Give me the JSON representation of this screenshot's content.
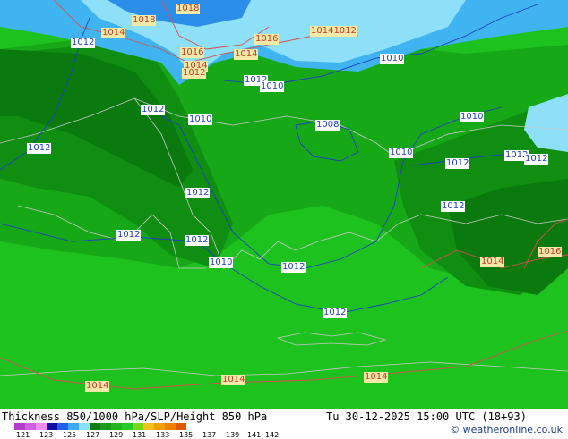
{
  "map": {
    "labels": [
      {
        "text": "1018",
        "color": "red"
      },
      {
        "text": "1018",
        "color": "red"
      },
      {
        "text": "1014",
        "color": "red"
      },
      {
        "text": "1012",
        "color": "blue"
      },
      {
        "text": "1016",
        "color": "red"
      },
      {
        "text": "10141012",
        "color": "red"
      },
      {
        "text": "1016",
        "color": "red"
      },
      {
        "text": "1014",
        "color": "red"
      },
      {
        "text": "1014",
        "color": "red"
      },
      {
        "text": "1012",
        "color": "red"
      },
      {
        "text": "1010",
        "color": "blue"
      },
      {
        "text": "1012",
        "color": "blue"
      },
      {
        "text": "1010",
        "color": "blue"
      },
      {
        "text": "1012",
        "color": "blue"
      },
      {
        "text": "1010",
        "color": "blue"
      },
      {
        "text": "1008",
        "color": "blue"
      },
      {
        "text": "1010",
        "color": "blue"
      },
      {
        "text": "1012",
        "color": "blue"
      },
      {
        "text": "1010",
        "color": "blue"
      },
      {
        "text": "1012",
        "color": "blue"
      },
      {
        "text": "1012",
        "color": "blue"
      },
      {
        "text": "1012",
        "color": "blue"
      },
      {
        "text": "1012",
        "color": "blue"
      },
      {
        "text": "1012",
        "color": "blue"
      },
      {
        "text": "1012",
        "color": "blue"
      },
      {
        "text": "1012",
        "color": "blue"
      },
      {
        "text": "1010",
        "color": "blue"
      },
      {
        "text": "1012",
        "color": "blue"
      },
      {
        "text": "1014",
        "color": "red"
      },
      {
        "text": "1016",
        "color": "red"
      },
      {
        "text": "1014",
        "color": "red"
      },
      {
        "text": "1014",
        "color": "red"
      },
      {
        "text": "1014",
        "color": "red"
      },
      {
        "text": "1012",
        "color": "blue"
      }
    ]
  },
  "footer": {
    "title": "Thickness 850/1000 hPa/SLP/Height 850 hPa",
    "datetime": "Tu 30-12-2025 15:00 UTC (18+93)",
    "credit": "© weatheronline.co.uk",
    "legend_colors": [
      "#b03cc8",
      "#d060e0",
      "#ee8ef2",
      "#1010a0",
      "#2060e8",
      "#40a8f0",
      "#8ee0f8",
      "#107a10",
      "#189a18",
      "#22b422",
      "#28c828",
      "#7ad818",
      "#f0c020",
      "#f0a000",
      "#f08000",
      "#e05800"
    ],
    "legend_ticks": [
      "121",
      "123",
      "125",
      "127",
      "129",
      "131",
      "133",
      "135",
      "137",
      "139",
      "141",
      "142"
    ]
  }
}
